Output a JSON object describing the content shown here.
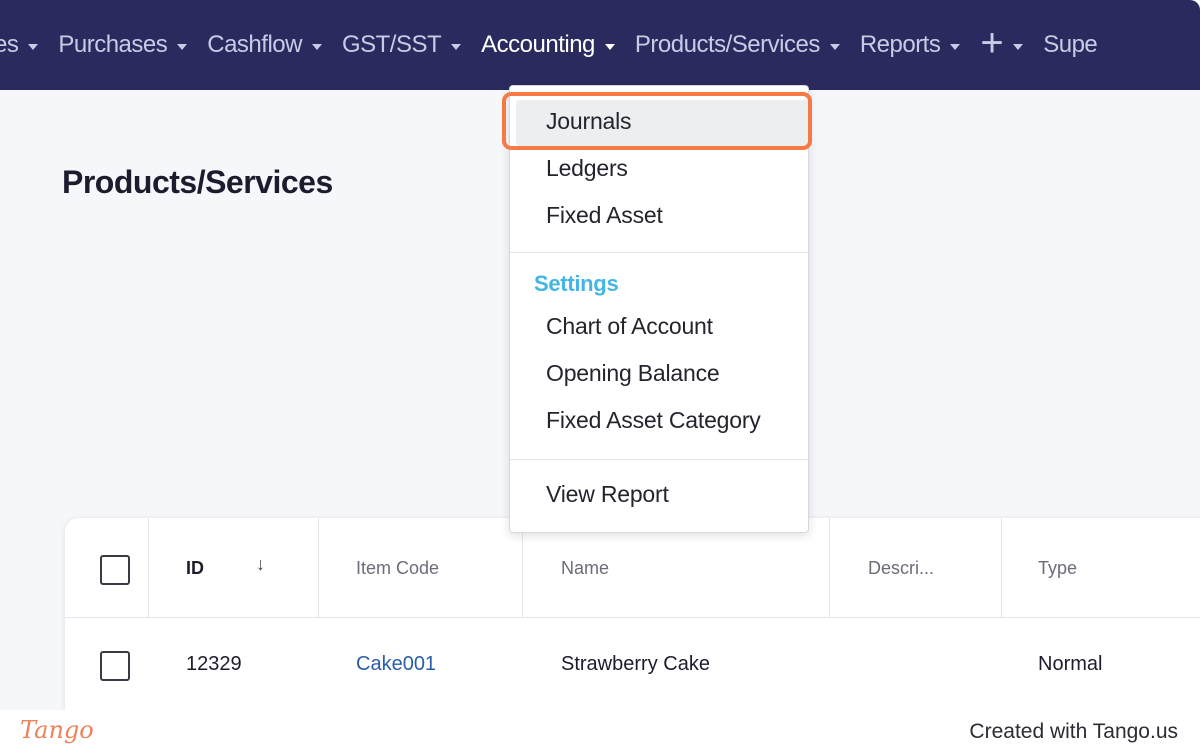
{
  "nav": {
    "items": [
      {
        "label": "es"
      },
      {
        "label": "Purchases"
      },
      {
        "label": "Cashflow"
      },
      {
        "label": "GST/SST"
      },
      {
        "label": "Accounting"
      },
      {
        "label": "Products/Services"
      },
      {
        "label": "Reports"
      },
      {
        "label": "+"
      },
      {
        "label": "Supe"
      }
    ],
    "active": "Accounting"
  },
  "page": {
    "title": "Products/Services"
  },
  "dropdown": {
    "items": [
      "Journals",
      "Ledgers",
      "Fixed Asset"
    ],
    "settings_label": "Settings",
    "settings_items": [
      "Chart of Account",
      "Opening Balance",
      "Fixed Asset Category"
    ],
    "report_item": "View Report",
    "highlighted": "Journals"
  },
  "table": {
    "columns": [
      "ID",
      "Item Code",
      "Name",
      "Descri...",
      "Type"
    ],
    "sort_icon": "arrow-down-icon",
    "rows": [
      {
        "id": "12329",
        "item_code": "Cake001",
        "name": "Strawberry Cake",
        "description": "",
        "type": "Normal"
      }
    ]
  },
  "footer": {
    "brand": "Tango",
    "created": "Created with Tango.us"
  },
  "colors": {
    "nav_bg": "#2a2a5e",
    "highlight": "#f47b45",
    "section": "#45b6e3",
    "link": "#2b5ea8"
  }
}
